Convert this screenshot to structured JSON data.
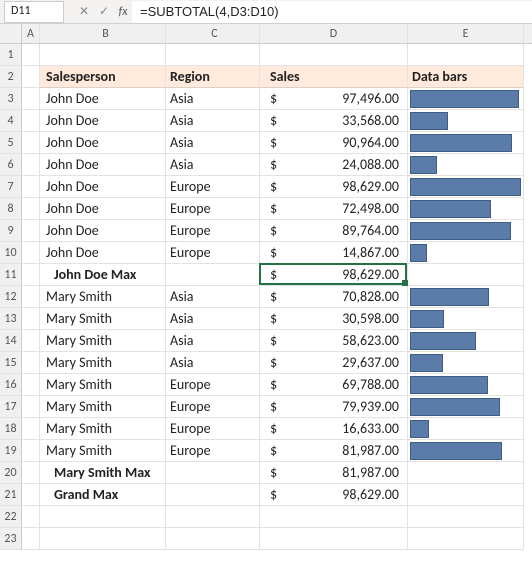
{
  "cellref": "D11",
  "formula": "=SUBTOTAL(4,D3:D10)",
  "currency": "$",
  "cols": [
    "A",
    "B",
    "C",
    "D",
    "E"
  ],
  "headers": {
    "salesperson": "Salesperson",
    "region": "Region",
    "sales": "Sales",
    "databars": "Data bars"
  },
  "rows": [
    {
      "num": 1,
      "type": "blank"
    },
    {
      "num": 2,
      "type": "header"
    },
    {
      "num": 3,
      "type": "data",
      "person": "John Doe",
      "region": "Asia",
      "sales": "97,496.00",
      "bar": 98.5
    },
    {
      "num": 4,
      "type": "data",
      "person": "John Doe",
      "region": "Asia",
      "sales": "33,568.00",
      "bar": 33.9
    },
    {
      "num": 5,
      "type": "data",
      "person": "John Doe",
      "region": "Asia",
      "sales": "90,964.00",
      "bar": 91.9
    },
    {
      "num": 6,
      "type": "data",
      "person": "John Doe",
      "region": "Asia",
      "sales": "24,088.00",
      "bar": 24.4
    },
    {
      "num": 7,
      "type": "data",
      "person": "John Doe",
      "region": "Europe",
      "sales": "98,629.00",
      "bar": 99.7
    },
    {
      "num": 8,
      "type": "data",
      "person": "John Doe",
      "region": "Europe",
      "sales": "72,498.00",
      "bar": 73.3
    },
    {
      "num": 9,
      "type": "data",
      "person": "John Doe",
      "region": "Europe",
      "sales": "89,764.00",
      "bar": 90.7
    },
    {
      "num": 10,
      "type": "data",
      "person": "John Doe",
      "region": "Europe",
      "sales": "14,867.00",
      "bar": 15.0
    },
    {
      "num": 11,
      "type": "subtotal",
      "label": "John Doe Max",
      "sales": "98,629.00",
      "active": true
    },
    {
      "num": 12,
      "type": "data",
      "person": "Mary Smith",
      "region": "Asia",
      "sales": "70,828.00",
      "bar": 71.6
    },
    {
      "num": 13,
      "type": "data",
      "person": "Mary Smith",
      "region": "Asia",
      "sales": "30,598.00",
      "bar": 30.9
    },
    {
      "num": 14,
      "type": "data",
      "person": "Mary Smith",
      "region": "Asia",
      "sales": "58,623.00",
      "bar": 59.2
    },
    {
      "num": 15,
      "type": "data",
      "person": "Mary Smith",
      "region": "Asia",
      "sales": "29,637.00",
      "bar": 30.0
    },
    {
      "num": 16,
      "type": "data",
      "person": "Mary Smith",
      "region": "Europe",
      "sales": "69,788.00",
      "bar": 70.5
    },
    {
      "num": 17,
      "type": "data",
      "person": "Mary Smith",
      "region": "Europe",
      "sales": "79,939.00",
      "bar": 80.8
    },
    {
      "num": 18,
      "type": "data",
      "person": "Mary Smith",
      "region": "Europe",
      "sales": "16,633.00",
      "bar": 16.8
    },
    {
      "num": 19,
      "type": "data",
      "person": "Mary Smith",
      "region": "Europe",
      "sales": "81,987.00",
      "bar": 82.8
    },
    {
      "num": 20,
      "type": "subtotal",
      "label": "Mary Smith Max",
      "sales": "81,987.00"
    },
    {
      "num": 21,
      "type": "subtotal",
      "label": "Grand Max",
      "sales": "98,629.00"
    },
    {
      "num": 22,
      "type": "blank"
    },
    {
      "num": 23,
      "type": "blank"
    }
  ],
  "chart_data": {
    "type": "bar",
    "title": "Data bars",
    "xlabel": "",
    "ylabel": "Sales",
    "ylim": [
      0,
      98900
    ],
    "categories": [
      "John Doe / Asia",
      "John Doe / Asia",
      "John Doe / Asia",
      "John Doe / Asia",
      "John Doe / Europe",
      "John Doe / Europe",
      "John Doe / Europe",
      "John Doe / Europe",
      "Mary Smith / Asia",
      "Mary Smith / Asia",
      "Mary Smith / Asia",
      "Mary Smith / Asia",
      "Mary Smith / Europe",
      "Mary Smith / Europe",
      "Mary Smith / Europe",
      "Mary Smith / Europe"
    ],
    "values": [
      97496,
      33568,
      90964,
      24088,
      98629,
      72498,
      89764,
      14867,
      70828,
      30598,
      58623,
      29637,
      69788,
      79939,
      16633,
      81987
    ]
  }
}
